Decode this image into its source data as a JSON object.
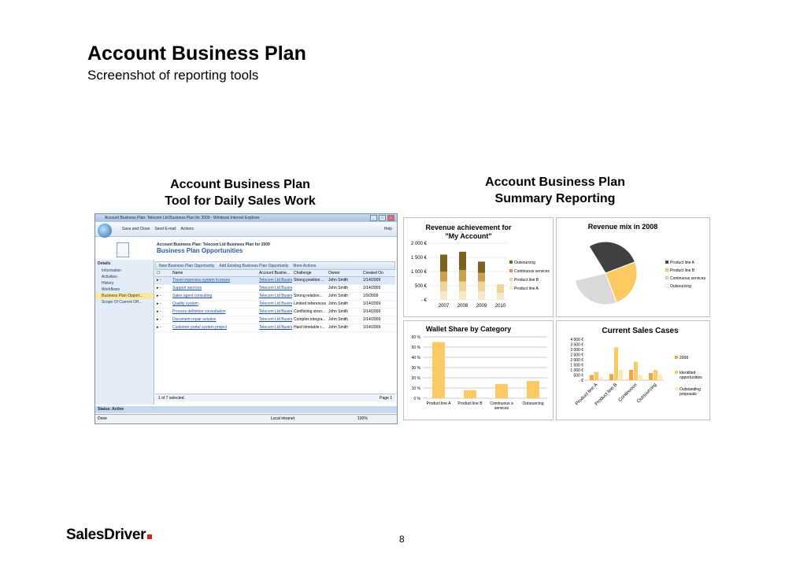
{
  "page": {
    "title": "Account Business Plan",
    "subtitle": "Screenshot of reporting tools",
    "number": "8",
    "logo": "SalesDriver"
  },
  "left_section": {
    "title_line1": "Account Business Plan",
    "title_line2": "Tool for Daily Sales Work"
  },
  "right_section": {
    "title_line1": "Account Business Plan",
    "title_line2": "Summary Reporting"
  },
  "ie_window": {
    "title": "Account Business Plan: Telecom Ltd Business Plan for 2009 - Windows Internet Explorer",
    "toolbar": [
      "Save and Close",
      "Send E-mail",
      "Actions",
      "Help"
    ],
    "header_line": "Account Business Plan: Telecom Ltd Business Plan for 2009",
    "header_title": "Business Plan Opportunities",
    "nav_header": "Details",
    "nav_items": [
      "Information",
      "Activities",
      "History",
      "Workflows",
      "Business Plan Opport...",
      "Scope Of Current Off..."
    ],
    "grid_toolbar": [
      "New Business Plan Opportunity",
      "Add Existing Business Plan Opportunity",
      "More Actions"
    ],
    "columns": [
      "Name",
      "Account Busine...",
      "Challenge",
      "Owner",
      "Created On"
    ],
    "rows": [
      [
        "Travel expenses system licenses",
        "Telecom Ltd Busine",
        "Strong position ...",
        "John Smith",
        "1/14/2009"
      ],
      [
        "Support services",
        "Telecom Ltd Busine",
        "",
        "John Smith",
        "1/14/2009"
      ],
      [
        "Sales agent consulting",
        "Telecom Ltd Busine",
        "Strong relation...",
        "John Smith",
        "1/9/2009"
      ],
      [
        "Quality system",
        "Telecom Ltd Busine",
        "Limited references",
        "John Smith",
        "1/14/2009"
      ],
      [
        "Process definition consultation",
        "Telecom Ltd Busine",
        "Conflicting stron...",
        "John Smith",
        "1/14/2009"
      ],
      [
        "Document repair solution",
        "Telecom Ltd Busine",
        "Complex integra...",
        "John Smith",
        "1/14/2009"
      ],
      [
        "Customer portal system project",
        "Telecom Ltd Busine",
        "Hard timetable r...",
        "John Smith",
        "1/14/2009"
      ]
    ],
    "grid_footer_left": "1 of 7 selected.",
    "grid_footer_right": "Page 1",
    "status_bar": "Status: Active",
    "ie_status": [
      "Done",
      "Local intranet",
      "100%"
    ]
  },
  "chart_data": [
    {
      "type": "bar",
      "title": "Revenue achievement for \"My Account\"",
      "categories": [
        "2007",
        "2008",
        "2009",
        "2010"
      ],
      "y_ticks": [
        "- €",
        "500 €",
        "1 000 €",
        "1 500 €",
        "2 000 €"
      ],
      "ylim": [
        0,
        2000
      ],
      "series": [
        {
          "name": "Product line A",
          "values": [
            300,
            300,
            300,
            250
          ]
        },
        {
          "name": "Product line B",
          "values": [
            350,
            350,
            350,
            300
          ]
        },
        {
          "name": "Continuous services",
          "values": [
            350,
            400,
            300,
            0
          ]
        },
        {
          "name": "Outsourcing",
          "values": [
            600,
            650,
            400,
            0
          ]
        }
      ],
      "legend": [
        "Outsourcing",
        "Continuous services",
        "Product line B",
        "Product line A"
      ],
      "colors": [
        "#7d6322",
        "#c8a34e",
        "#ecd399",
        "#f7e8c6"
      ]
    },
    {
      "type": "pie",
      "title": "Revenue mix in 2008",
      "series": [
        {
          "name": "Product line A",
          "value": 28
        },
        {
          "name": "Product line B",
          "value": 25
        },
        {
          "name": "Continuous services",
          "value": 27
        },
        {
          "name": "Outsourcing",
          "value": 20
        }
      ],
      "legend": [
        "Product line A",
        "Product line B",
        "Continuous services",
        "Outsourcing"
      ],
      "colors": [
        "#404040",
        "#fcca63",
        "#d9d9d9",
        "#ffffff"
      ]
    },
    {
      "type": "bar",
      "title": "Wallet Share by Category",
      "categories": [
        "Product line A",
        "Product line B",
        "Continuous services",
        "Outsourcing"
      ],
      "y_ticks": [
        "0 %",
        "10 %",
        "20 %",
        "30 %",
        "40 %",
        "50 %",
        "60 %"
      ],
      "ylim": [
        0,
        60
      ],
      "values": [
        55,
        8,
        14,
        17
      ],
      "colors": [
        "#fcca63"
      ]
    },
    {
      "type": "bar",
      "title": "Current Sales Cases",
      "categories": [
        "Product line A",
        "Product line B",
        "Continuous",
        "Outsourcing"
      ],
      "y_ticks": [
        "- €",
        "500 €",
        "1 000 €",
        "1 500 €",
        "2 000 €",
        "2 500 €",
        "3 000 €",
        "3 500 €",
        "4 000 €"
      ],
      "ylim": [
        0,
        4000
      ],
      "series": [
        {
          "name": "2008",
          "values": [
            500,
            600,
            1000,
            700
          ]
        },
        {
          "name": "Identified opportunities",
          "values": [
            800,
            3200,
            1800,
            1000
          ]
        },
        {
          "name": "Outstanding proposals",
          "values": [
            300,
            1000,
            500,
            500
          ]
        }
      ],
      "legend": [
        "2008",
        "Identified opportunities",
        "Outstanding proposals"
      ],
      "colors": [
        "#f4a53b",
        "#fcca63",
        "#fde8b6"
      ]
    }
  ]
}
